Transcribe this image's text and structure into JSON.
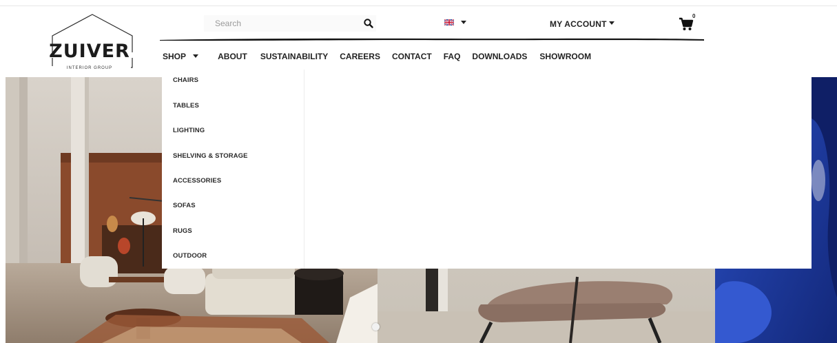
{
  "brand": {
    "logo_text": "ZUIVER",
    "logo_subtext": "INTERIOR GROUP"
  },
  "search": {
    "placeholder": "Search",
    "value": ""
  },
  "language": {
    "icon": "uk-flag-icon"
  },
  "account": {
    "label": "MY ACCOUNT"
  },
  "cart": {
    "count": "0",
    "icon": "cart-icon"
  },
  "nav": {
    "items": [
      {
        "label": "SHOP",
        "has_dropdown": true
      },
      {
        "label": "ABOUT"
      },
      {
        "label": "SUSTAINABILITY"
      },
      {
        "label": "CAREERS"
      },
      {
        "label": "CONTACT"
      },
      {
        "label": "FAQ"
      },
      {
        "label": "DOWNLOADS"
      },
      {
        "label": "SHOWROOM"
      }
    ]
  },
  "shop_menu": {
    "items": [
      "CHAIRS",
      "TABLES",
      "LIGHTING",
      "SHELVING & STORAGE",
      "ACCESSORIES",
      "SOFAS",
      "RUGS",
      "OUTDOOR"
    ]
  },
  "colors": {
    "text": "#222222",
    "hero_blue": "#1d3a9e",
    "chair_fabric": "#9a7f71"
  }
}
